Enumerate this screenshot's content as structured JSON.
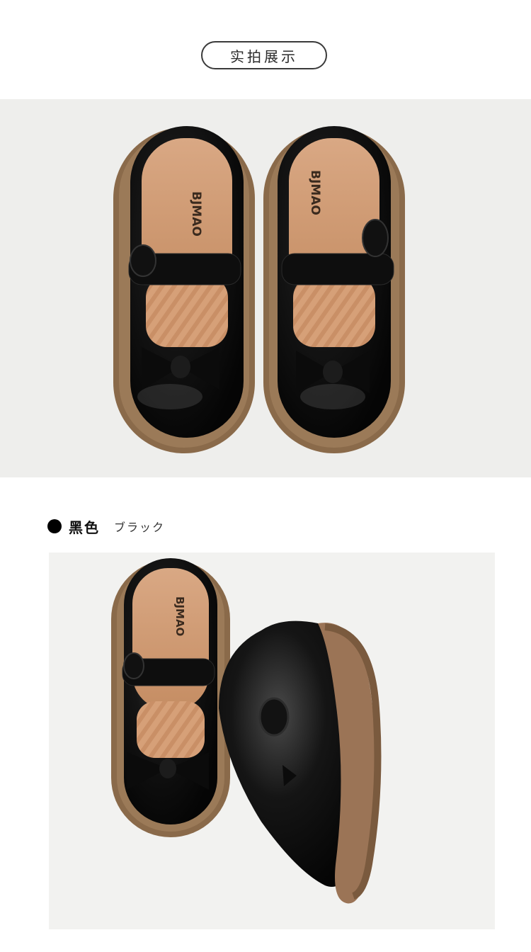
{
  "header": {
    "title": "实拍展示"
  },
  "photos": {
    "top": {
      "brand_left": "BJMAO",
      "brand_right": "BJMAO"
    },
    "bottom": {
      "brand": "BJMAO"
    }
  },
  "color_option": {
    "name": "黑色",
    "name_jp": "ブラック",
    "swatch": "#000000"
  }
}
